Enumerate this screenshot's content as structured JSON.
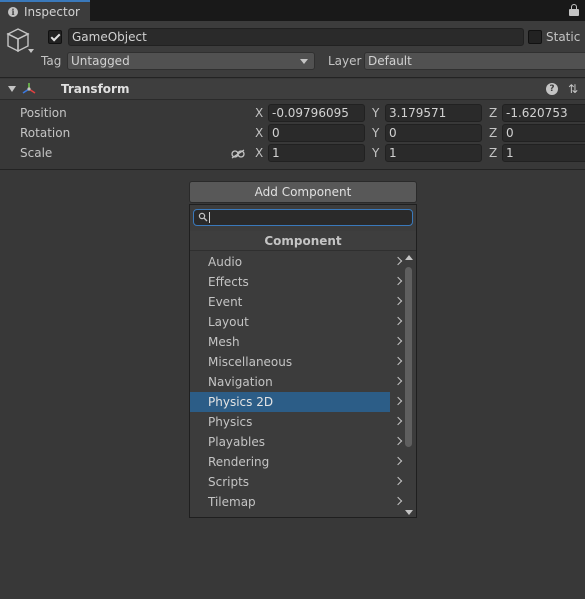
{
  "tab": {
    "label": "Inspector",
    "icon": "info-icon",
    "lock_icon": "lock-icon"
  },
  "gameobject": {
    "icon": "cube-icon",
    "active": true,
    "name": "GameObject",
    "static_label": "Static",
    "static": false,
    "tag_label": "Tag",
    "tag_value": "Untagged",
    "layer_label": "Layer",
    "layer_value": "Default"
  },
  "transform": {
    "title": "Transform",
    "icon": "transform-icon",
    "rows": [
      {
        "label": "Position",
        "x_axis": "X",
        "x": "-0.09796095",
        "y_axis": "Y",
        "y": "3.179571",
        "z_axis": "Z",
        "z": "-1.620753"
      },
      {
        "label": "Rotation",
        "x_axis": "X",
        "x": "0",
        "y_axis": "Y",
        "y": "0",
        "z_axis": "Z",
        "z": "0"
      },
      {
        "label": "Scale",
        "x_axis": "X",
        "x": "1",
        "y_axis": "Y",
        "y": "1",
        "z_axis": "Z",
        "z": "1"
      }
    ]
  },
  "add_component": {
    "button_label": "Add Component",
    "search_value": "",
    "list_title": "Component",
    "items": [
      {
        "label": "Audio"
      },
      {
        "label": "Effects"
      },
      {
        "label": "Event"
      },
      {
        "label": "Layout"
      },
      {
        "label": "Mesh"
      },
      {
        "label": "Miscellaneous"
      },
      {
        "label": "Navigation"
      },
      {
        "label": "Physics 2D",
        "selected": true
      },
      {
        "label": "Physics"
      },
      {
        "label": "Playables"
      },
      {
        "label": "Rendering"
      },
      {
        "label": "Scripts"
      },
      {
        "label": "Tilemap"
      }
    ],
    "selection_color": "#2c5d87"
  },
  "colors": {
    "accent": "#3a79bb",
    "panel": "#383838",
    "header": "#3c3c3c"
  }
}
